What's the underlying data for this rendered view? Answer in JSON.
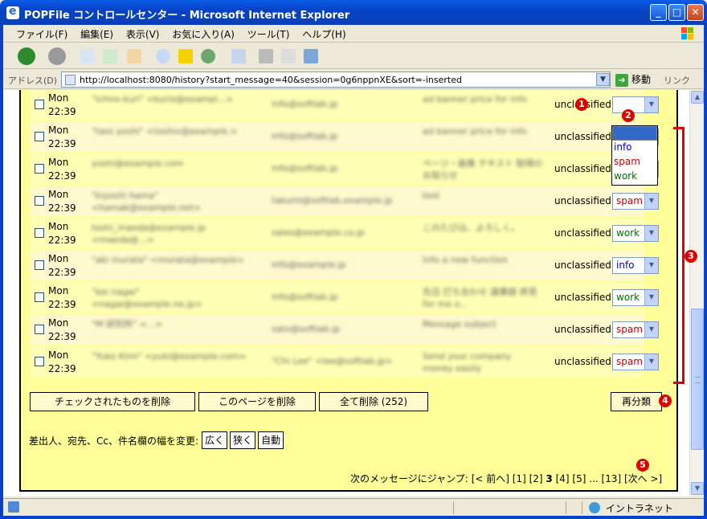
{
  "window": {
    "title": "POPFile コントロールセンター - Microsoft Internet Explorer"
  },
  "menu": [
    "ファイル(F)",
    "編集(E)",
    "表示(V)",
    "お気に入り(A)",
    "ツール(T)",
    "ヘルプ(H)"
  ],
  "address": {
    "label": "アドレス(D)",
    "url": "http://localhost:8080/history?start_message=40&session=0g6nppnXE&sort=-inserted",
    "go_label": "移動",
    "links_label": "リンク"
  },
  "rows": [
    {
      "day": "Mon",
      "time": "22:39",
      "from": "\"ichiro-kuri\" <kurio@exampl...>",
      "to": "info@softlab.jp",
      "subject": "ad banner price for info",
      "status": "unclassified",
      "bucket": "",
      "bucket_color": "#000000"
    },
    {
      "day": "Mon",
      "time": "22:39",
      "from": "\"taro yoshi\" <toshiv@example.>",
      "to": "info@softlab.jp",
      "subject": "ad banner price for info",
      "status": "unclassified",
      "bucket": "",
      "bucket_color": "#000000"
    },
    {
      "day": "Mon",
      "time": "22:39",
      "from": "yoshi@example.com",
      "to": "info@softlab.jp",
      "subject": "ページ・画像 テキスト 取得のお知らせ",
      "status": "unclassified",
      "bucket": "",
      "bucket_color": "#000000"
    },
    {
      "day": "Mon",
      "time": "22:39",
      "from": "\"kiyoshi hama\" <hamak@example.net>",
      "to": "takumi@softlab.example.jp",
      "subject": "test",
      "status": "unclassified",
      "bucket": "spam",
      "bucket_color": "#cc0000"
    },
    {
      "day": "Mon",
      "time": "22:39",
      "from": "toshi_maeda@example.jp <maeda@...>",
      "to": "sales@example.co.jp",
      "subject": "このたびは、よろしく。",
      "status": "unclassified",
      "bucket": "work",
      "bucket_color": "#007000"
    },
    {
      "day": "Mon",
      "time": "22:39",
      "from": "\"aki murata\" <murata@example>",
      "to": "info@example.jp",
      "subject": "Info a new function",
      "status": "unclassified",
      "bucket": "info",
      "bucket_color": "#0000cc"
    },
    {
      "day": "Mon",
      "time": "22:39",
      "from": "\"kei nagai\" <nagai@example.ne.jp>",
      "to": "info@softlab.jp",
      "subject": "先日 打ち合わせ 議事録 拝見 for me o...",
      "status": "unclassified",
      "bucket": "work",
      "bucket_color": "#007000"
    },
    {
      "day": "Mon",
      "time": "22:39",
      "from": "\"M 研究所\" <...>",
      "to": "sato@softlab.jp",
      "subject": "Message subject",
      "status": "unclassified",
      "bucket": "spam",
      "bucket_color": "#cc0000"
    },
    {
      "day": "Mon",
      "time": "22:39",
      "from": "\"Yuko Kimi\" <yuki@example.com>",
      "to": "\"Chi Lee\" <lee@softlab.jp>",
      "subject": "Send your company money easily",
      "status": "unclassified",
      "bucket": "spam",
      "bucket_color": "#cc0000"
    }
  ],
  "dropdown": {
    "options": [
      "",
      "info",
      "spam",
      "work"
    ]
  },
  "actions": {
    "delete_checked": "チェックされたものを削除",
    "delete_page": "このページを削除",
    "delete_all": "全て削除 (252)",
    "reclassify": "再分類"
  },
  "width_control": {
    "label": "差出人、宛先、Cc、件名欄の幅を変更:",
    "wide": "広く",
    "narrow": "狭く",
    "auto": "自動"
  },
  "pagination": {
    "label": "次のメッセージにジャンプ:",
    "prev": "[< 前へ]",
    "p1": "[1]",
    "p2": "[2]",
    "p3": "3",
    "p4": "[4]",
    "p5": "[5]",
    "ellipsis": "...",
    "p13": "[13]",
    "next": "[次へ >]"
  },
  "callouts": [
    "1",
    "2",
    "3",
    "4",
    "5"
  ],
  "status": {
    "zone": "イントラネット"
  }
}
